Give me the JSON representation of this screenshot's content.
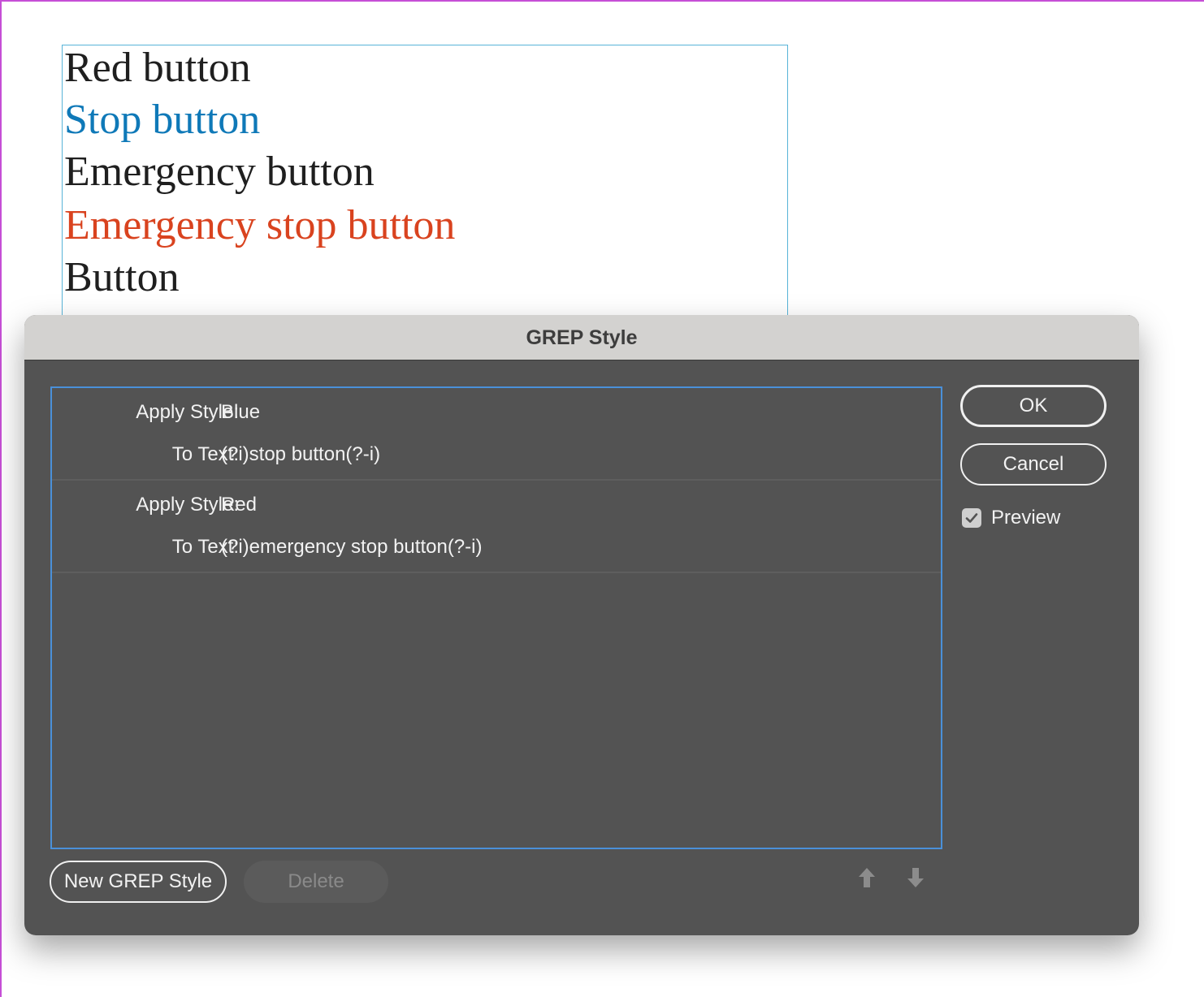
{
  "document": {
    "lines": [
      {
        "text": "Red button",
        "color": "#1f1f1f"
      },
      {
        "text": "Stop button",
        "color": "#0f79b8"
      },
      {
        "text": "Emergency button",
        "color": "#1f1f1f"
      },
      {
        "text": "Emergency stop button",
        "color": "#d9431f"
      },
      {
        "text": "Button",
        "color": "#1f1f1f"
      }
    ]
  },
  "dialog": {
    "title": "GREP Style",
    "rules": [
      {
        "apply_label": "Apply Style:",
        "style": "Blue",
        "to_text_label": "To Text:",
        "pattern": "(?i)stop button(?-i)"
      },
      {
        "apply_label": "Apply Style:",
        "style": "Red",
        "to_text_label": "To Text:",
        "pattern": "(?i)emergency stop button(?-i)"
      }
    ],
    "ok_label": "OK",
    "cancel_label": "Cancel",
    "preview_label": "Preview",
    "preview_checked": true,
    "new_label": "New GREP Style",
    "delete_label": "Delete",
    "icons": {
      "move_up": "arrow-up-icon",
      "move_down": "arrow-down-icon"
    }
  }
}
